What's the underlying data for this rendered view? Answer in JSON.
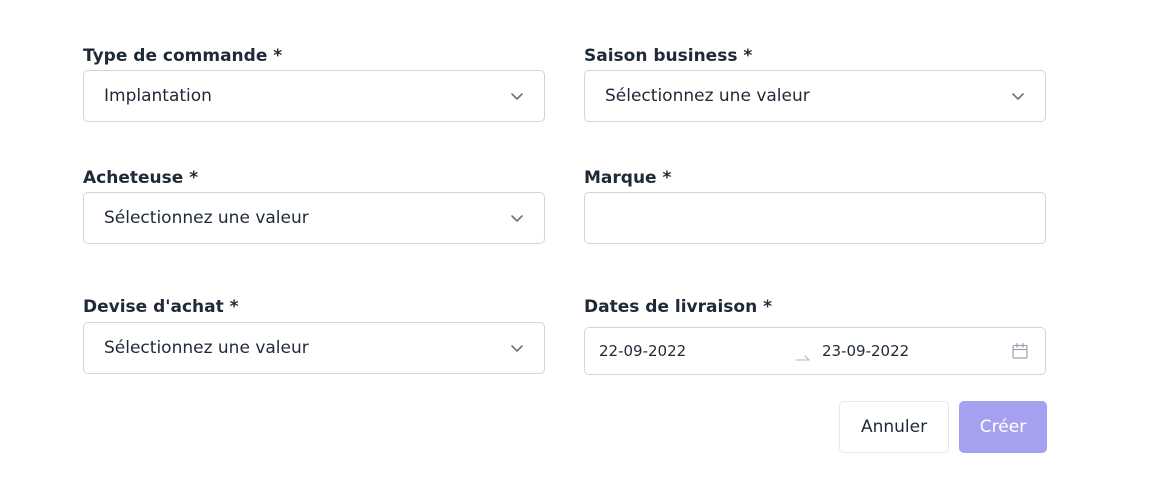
{
  "form": {
    "order_type": {
      "label": "Type de commande *",
      "value": "Implantation"
    },
    "business_season": {
      "label": "Saison business *",
      "value": "Sélectionnez une valeur"
    },
    "buyer": {
      "label": "Acheteuse *",
      "value": "Sélectionnez une valeur"
    },
    "brand": {
      "label": "Marque *",
      "value": ""
    },
    "purchase_currency": {
      "label": "Devise d'achat *",
      "value": "Sélectionnez une valeur"
    },
    "delivery_dates": {
      "label": "Dates de livraison *",
      "start": "22-09-2022",
      "end": "23-09-2022"
    }
  },
  "actions": {
    "cancel_label": "Annuler",
    "create_label": "Créer"
  },
  "colors": {
    "primary_disabled": "#a5a0f0",
    "border": "#d1d5db",
    "text": "#1f2937"
  },
  "icons": {
    "select_arrow": "chevron-down-icon",
    "date_picker": "calendar-icon",
    "range_separator": "arrow-right-icon"
  }
}
